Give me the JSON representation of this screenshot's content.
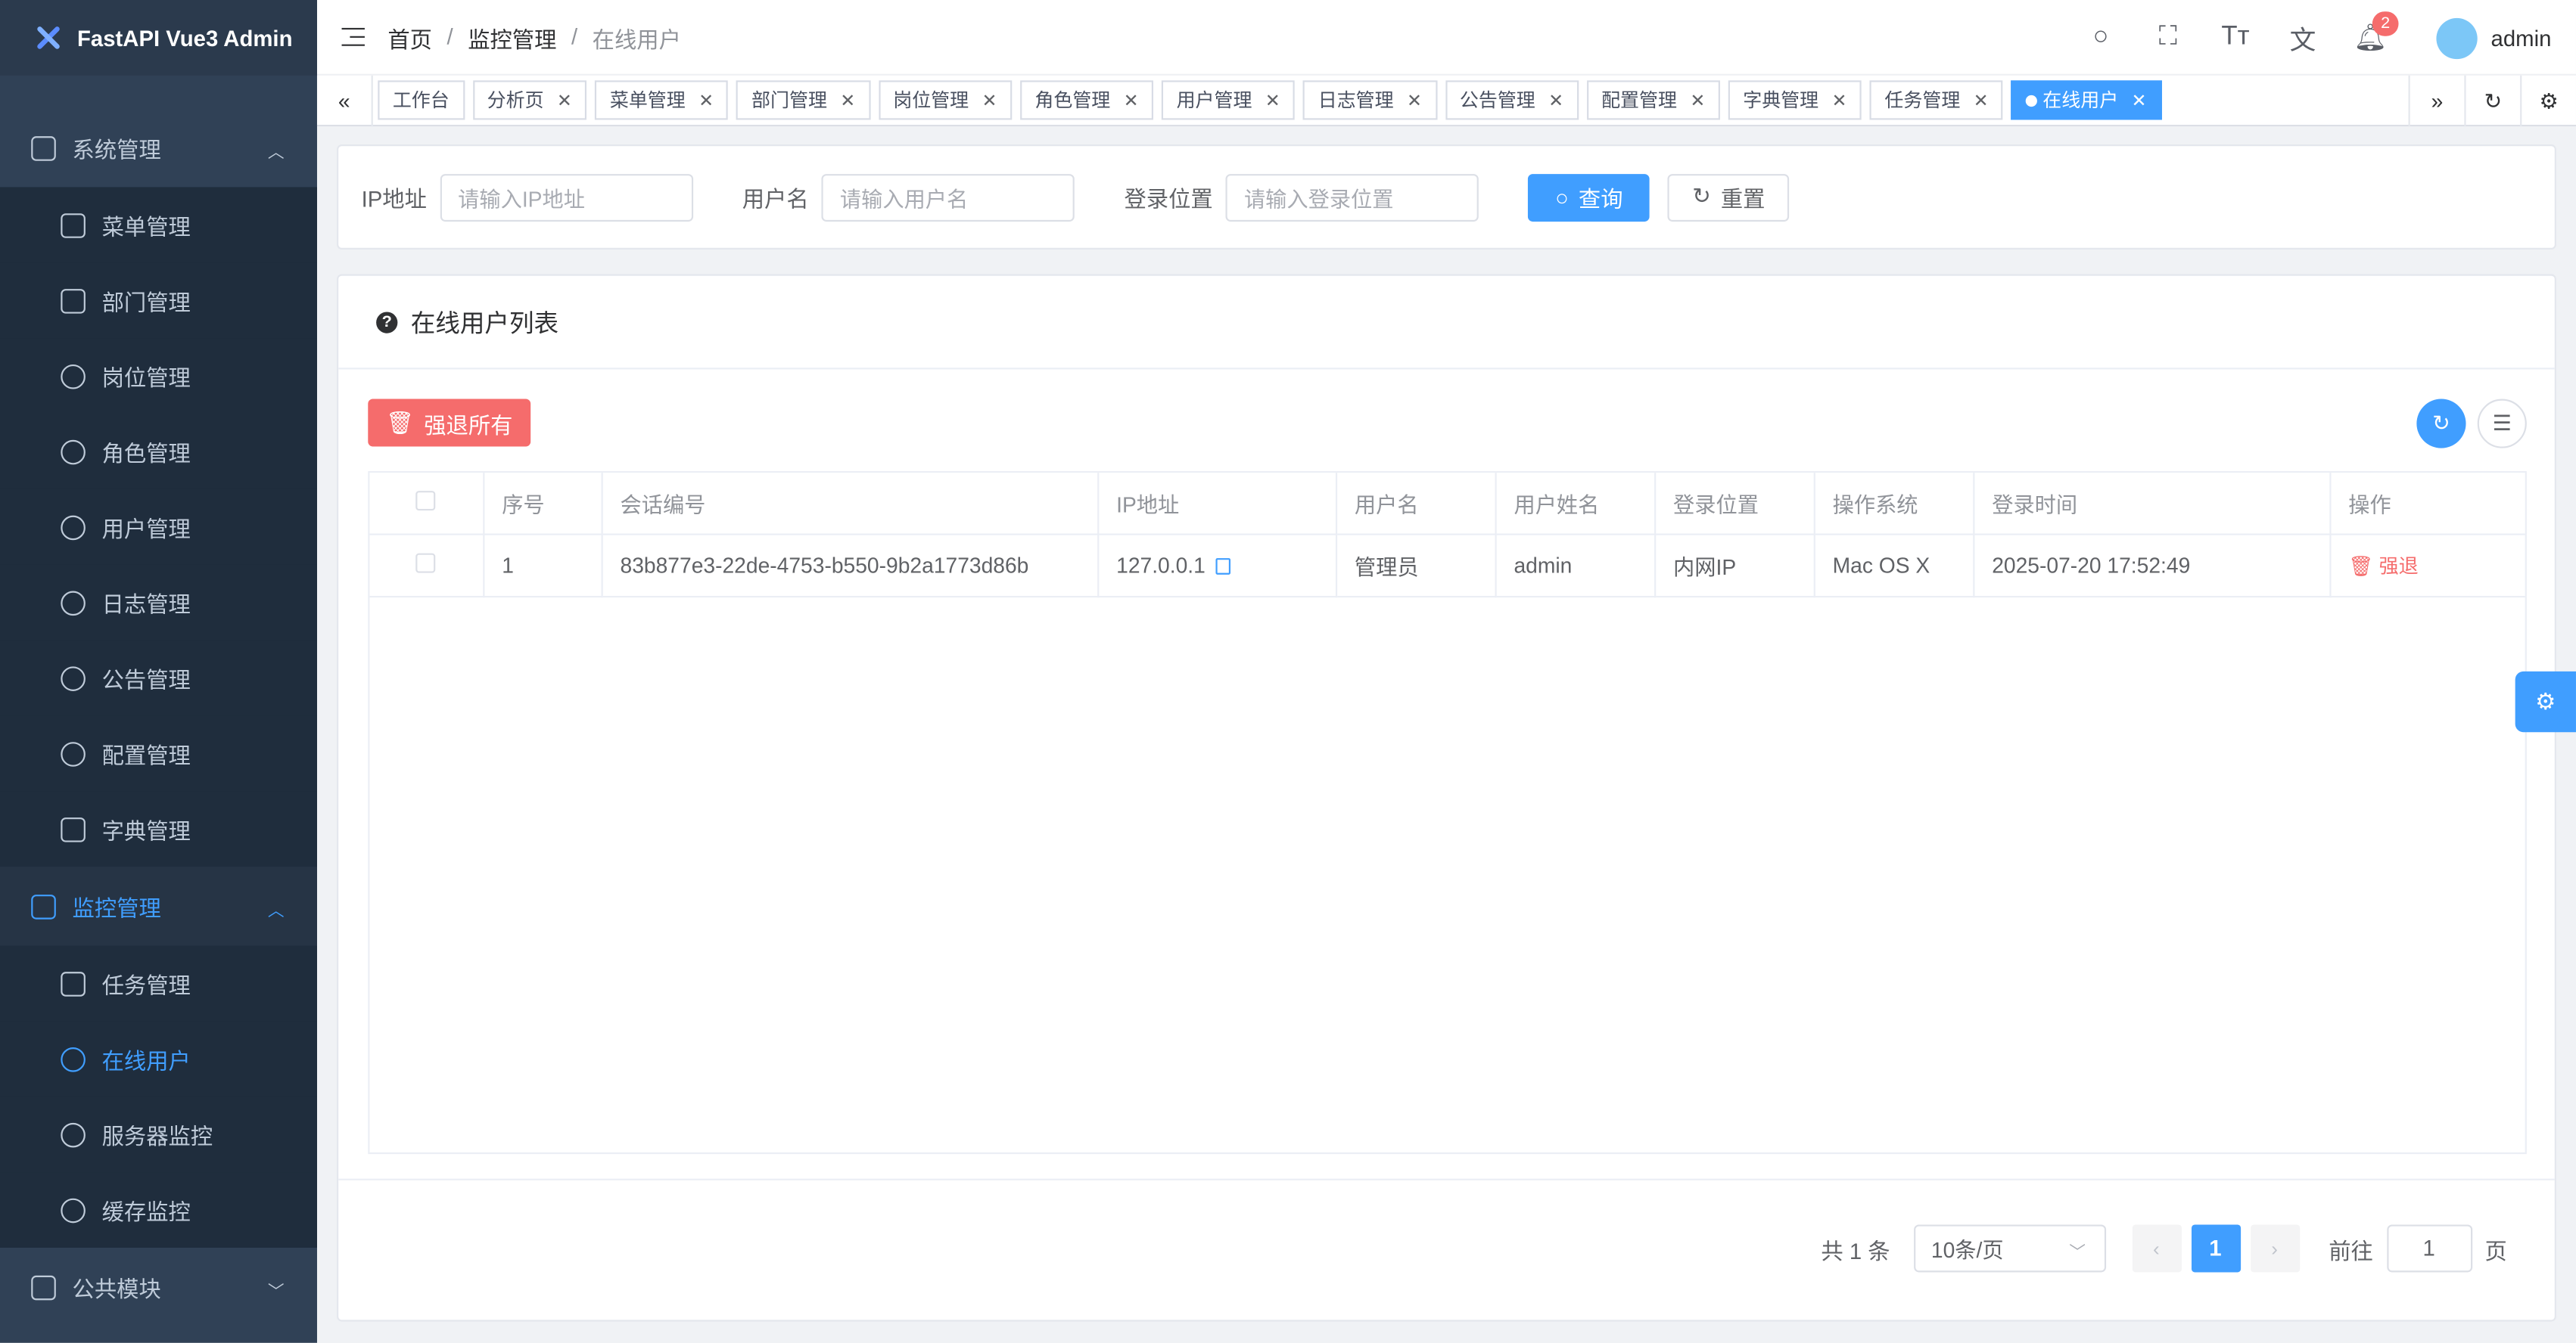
{
  "app": {
    "title": "FastAPI Vue3 Admin"
  },
  "sidebar": {
    "groups": [
      {
        "label": "系统管理",
        "expanded": true
      },
      {
        "label": "监控管理",
        "expanded": true
      },
      {
        "label": "公共模块",
        "expanded": false
      }
    ],
    "system_items": [
      {
        "label": "菜单管理",
        "icon": "grid-icon"
      },
      {
        "label": "部门管理",
        "icon": "org-chart-icon"
      },
      {
        "label": "岗位管理",
        "icon": "user-post-icon"
      },
      {
        "label": "角色管理",
        "icon": "role-icon"
      },
      {
        "label": "用户管理",
        "icon": "user-icon"
      },
      {
        "label": "日志管理",
        "icon": "log-icon"
      },
      {
        "label": "公告管理",
        "icon": "bell-icon"
      },
      {
        "label": "配置管理",
        "icon": "config-icon"
      },
      {
        "label": "字典管理",
        "icon": "dictionary-icon"
      }
    ],
    "monitor_items": [
      {
        "label": "任务管理",
        "icon": "task-icon"
      },
      {
        "label": "在线用户",
        "icon": "headset-icon",
        "active": true
      },
      {
        "label": "服务器监控",
        "icon": "gauge-icon"
      },
      {
        "label": "缓存监控",
        "icon": "compass-icon"
      }
    ]
  },
  "header": {
    "breadcrumb": [
      "首页",
      "监控管理",
      "在线用户"
    ],
    "user": "admin",
    "notification_count": "2"
  },
  "tags": [
    {
      "label": "工作台",
      "closable": false
    },
    {
      "label": "分析页",
      "closable": true
    },
    {
      "label": "菜单管理",
      "closable": true
    },
    {
      "label": "部门管理",
      "closable": true
    },
    {
      "label": "岗位管理",
      "closable": true
    },
    {
      "label": "角色管理",
      "closable": true
    },
    {
      "label": "用户管理",
      "closable": true
    },
    {
      "label": "日志管理",
      "closable": true
    },
    {
      "label": "公告管理",
      "closable": true
    },
    {
      "label": "配置管理",
      "closable": true
    },
    {
      "label": "字典管理",
      "closable": true
    },
    {
      "label": "任务管理",
      "closable": true
    },
    {
      "label": "在线用户",
      "closable": true,
      "active": true
    }
  ],
  "search": {
    "ip_label": "IP地址",
    "ip_placeholder": "请输入IP地址",
    "user_label": "用户名",
    "user_placeholder": "请输入用户名",
    "loc_label": "登录位置",
    "loc_placeholder": "请输入登录位置",
    "query": "查询",
    "reset": "重置"
  },
  "table_card": {
    "title": "在线用户列表",
    "force_all": "强退所有",
    "columns": [
      "序号",
      "会话编号",
      "IP地址",
      "用户名",
      "用户姓名",
      "登录位置",
      "操作系统",
      "登录时间",
      "操作"
    ],
    "rows": [
      {
        "index": "1",
        "session": "83b877e3-22de-4753-b550-9b2a1773d86b",
        "ip": "127.0.0.1",
        "username": "管理员",
        "name": "admin",
        "location": "内网IP",
        "os": "Mac OS X",
        "login_time": "2025-07-20 17:52:49",
        "action": "强退"
      }
    ]
  },
  "pagination": {
    "total": "共 1 条",
    "page_size": "10条/页",
    "current": "1",
    "goto_prefix": "前往",
    "goto_value": "1",
    "goto_suffix": "页"
  },
  "colors": {
    "primary": "#409eff",
    "danger": "#f56c6c",
    "sidebar_bg": "#304156"
  }
}
